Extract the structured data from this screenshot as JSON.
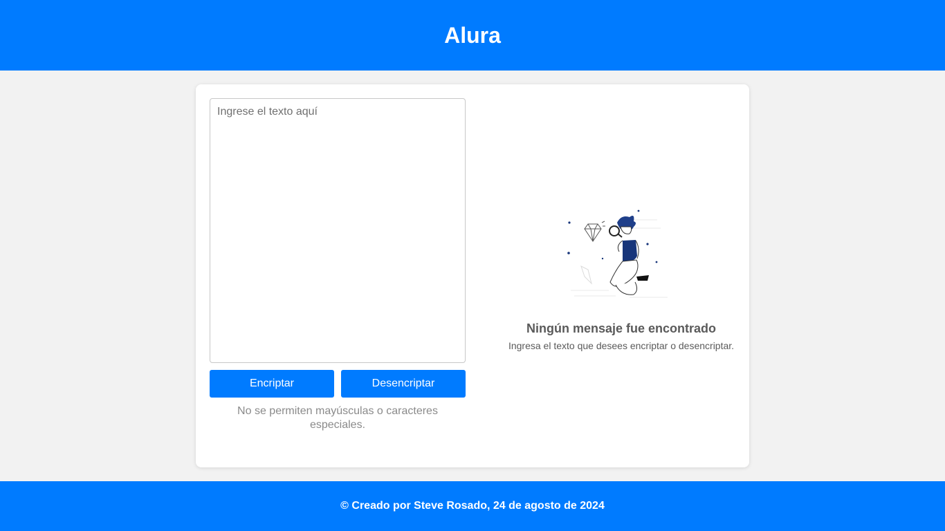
{
  "header": {
    "title": "Alura"
  },
  "input": {
    "placeholder": "Ingrese el texto aquí",
    "value": ""
  },
  "actions": {
    "encrypt_label": "Encriptar",
    "decrypt_label": "Desencriptar"
  },
  "hint": "No se permiten mayúsculas o caracteres especiales.",
  "output": {
    "empty_title": "Ningún mensaje fue encontrado",
    "empty_subtitle": "Ingresa el texto que desees encriptar o desencriptar.",
    "illustration": "person-with-magnifying-glass-and-diamond"
  },
  "footer": {
    "text": "© Creado por Steve Rosado, 24 de agosto de 2024"
  },
  "colors": {
    "brand": "#007bff",
    "background": "#f2f2f2",
    "accent_green": "#14b04f"
  }
}
